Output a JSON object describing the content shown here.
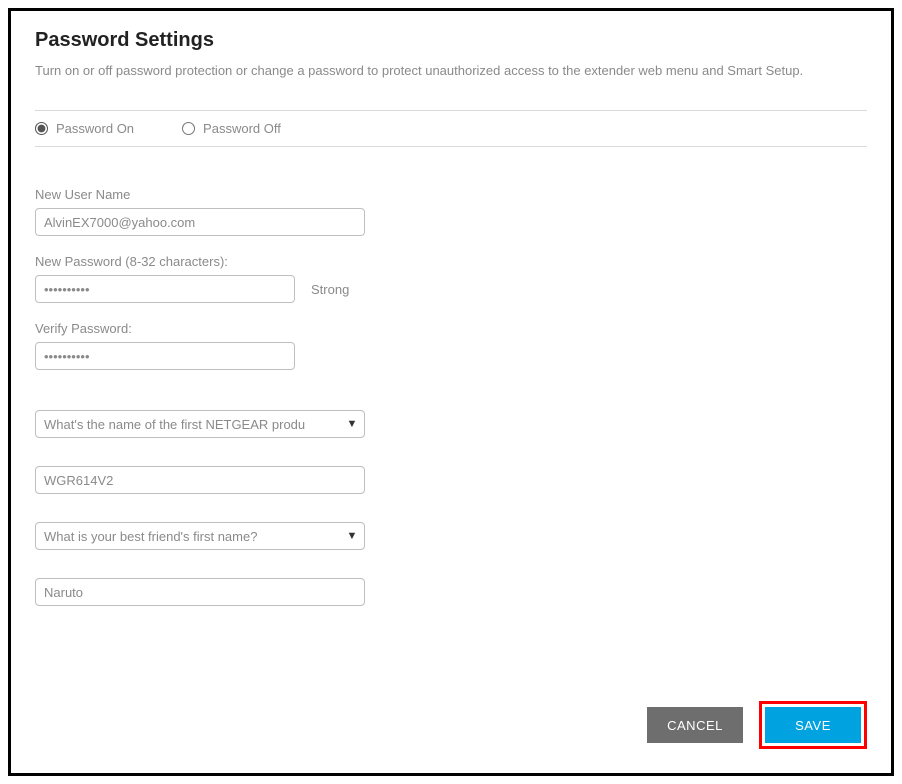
{
  "header": {
    "title": "Password Settings",
    "description": "Turn on or off password protection or change a password to protect unauthorized access to the extender web menu and Smart Setup."
  },
  "radio": {
    "on_label": "Password On",
    "off_label": "Password Off",
    "selected": "on"
  },
  "fields": {
    "username_label": "New User Name",
    "username_value": "AlvinEX7000@yahoo.com",
    "new_password_label": "New Password (8-32 characters):",
    "new_password_value": "••••••••••",
    "strength": "Strong",
    "verify_password_label": "Verify Password:",
    "verify_password_value": "••••••••••"
  },
  "security": {
    "q1_selected": "What's the name of the first NETGEAR produ",
    "a1_value": "WGR614V2",
    "q2_selected": "What is your best friend's first name?",
    "a2_value": "Naruto"
  },
  "buttons": {
    "cancel": "CANCEL",
    "save": "SAVE"
  }
}
